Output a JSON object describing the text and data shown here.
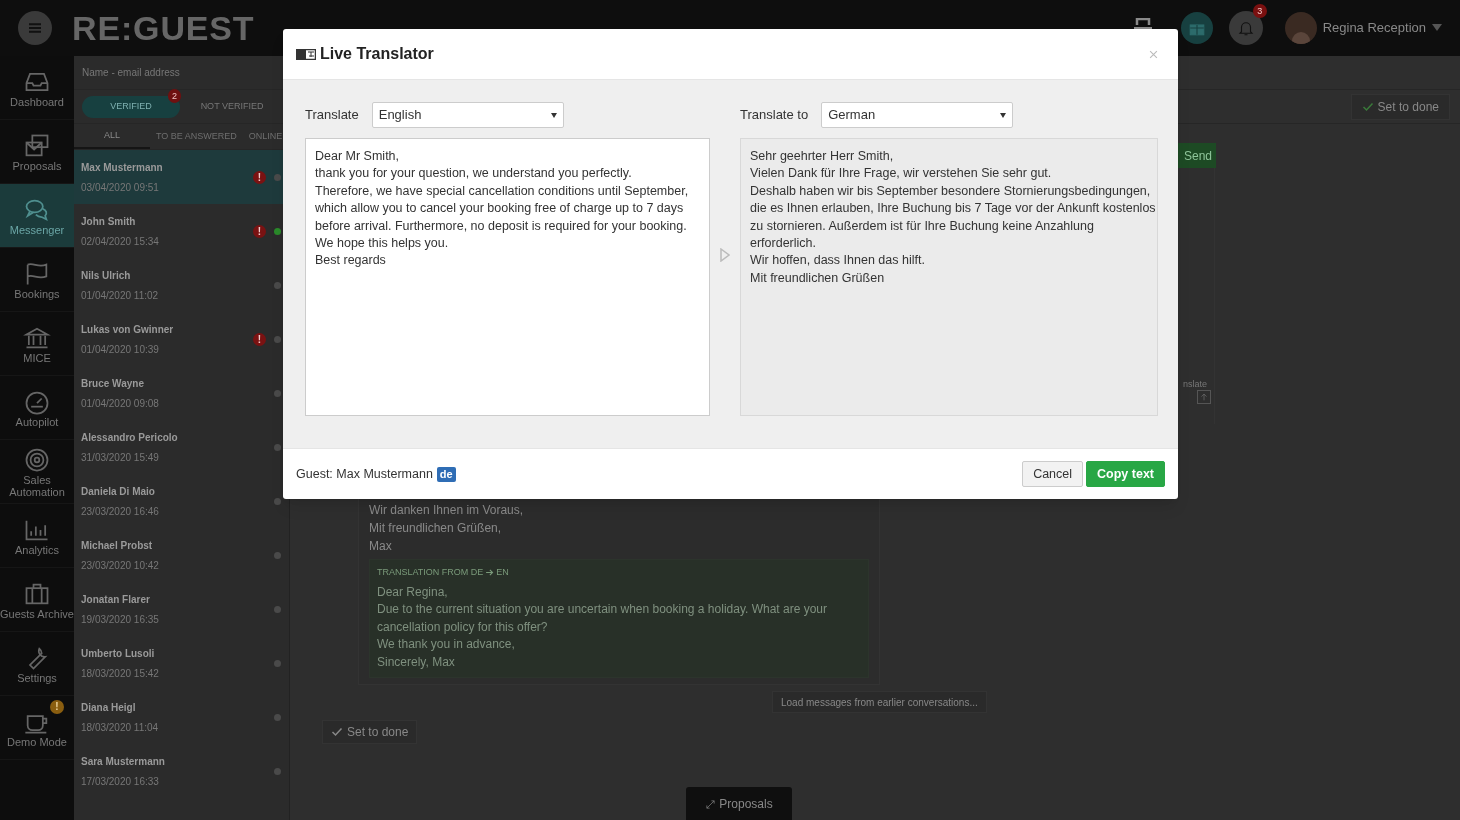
{
  "header": {
    "logo": "RE:GUEST",
    "notifications": "3",
    "user": "Regina Reception"
  },
  "nav": [
    {
      "label": "Dashboard",
      "selected": false
    },
    {
      "label": "Proposals",
      "selected": false
    },
    {
      "label": "Messenger",
      "selected": true
    },
    {
      "label": "Bookings",
      "selected": false
    },
    {
      "label": "MICE",
      "selected": false
    },
    {
      "label": "Autopilot",
      "selected": false
    },
    {
      "label": "Sales Automation",
      "selected": false
    },
    {
      "label": "Analytics",
      "selected": false
    },
    {
      "label": "Guests Archive",
      "selected": false
    },
    {
      "label": "Settings",
      "selected": false
    },
    {
      "label": "Demo Mode",
      "selected": false,
      "badge": "!"
    }
  ],
  "conversations_panel": {
    "search": {
      "placeholder": "Name - email address"
    },
    "filters": [
      {
        "label": "VERIFIED",
        "selected": true,
        "badge": "2"
      },
      {
        "label": "NOT VERIFIED",
        "selected": false
      }
    ],
    "tabs": [
      {
        "label": "ALL",
        "selected": true
      },
      {
        "label": "TO BE ANSWERED",
        "selected": false
      },
      {
        "label": "ONLINE",
        "selected": false
      }
    ],
    "items": [
      {
        "name": "Max Mustermann",
        "date": "03/04/2020 09:51",
        "selected": true,
        "alert": "!",
        "online": false
      },
      {
        "name": "John Smith",
        "date": "02/04/2020 15:34",
        "selected": false,
        "alert": "!",
        "online": true
      },
      {
        "name": "Nils Ulrich",
        "date": "01/04/2020 11:02",
        "selected": false,
        "alert": false,
        "online": false
      },
      {
        "name": "Lukas von Gwinner",
        "date": "01/04/2020 10:39",
        "selected": false,
        "alert": "!",
        "online": false
      },
      {
        "name": "Bruce Wayne",
        "date": "01/04/2020 09:08",
        "selected": false,
        "alert": false,
        "online": false
      },
      {
        "name": "Alessandro Pericolo",
        "date": "31/03/2020 15:49",
        "selected": false,
        "alert": false,
        "online": false
      },
      {
        "name": "Daniela Di Maio",
        "date": "23/03/2020 16:46",
        "selected": false,
        "alert": false,
        "online": false
      },
      {
        "name": "Michael Probst",
        "date": "23/03/2020 10:42",
        "selected": false,
        "alert": false,
        "online": false
      },
      {
        "name": "Jonatan Flarer",
        "date": "19/03/2020 16:35",
        "selected": false,
        "alert": false,
        "online": false
      },
      {
        "name": "Umberto Lusoli",
        "date": "18/03/2020 15:42",
        "selected": false,
        "alert": false,
        "online": false
      },
      {
        "name": "Diana Heigl",
        "date": "18/03/2020 11:04",
        "selected": false,
        "alert": false,
        "online": false
      },
      {
        "name": "Sara Mustermann",
        "date": "17/03/2020 16:33",
        "selected": false,
        "alert": false,
        "online": false
      }
    ]
  },
  "conversation": {
    "set_done_top": "Set to done",
    "send": "Send",
    "translate_fragment": "nslate",
    "message_lines": [
      "Wir danken Ihnen im Voraus,",
      "Mit freundlichen Grüßen,",
      "Max"
    ],
    "translation": {
      "label": "TRANSLATION FROM DE",
      "target": "EN",
      "text": "Dear Regina,\nDue to the current situation you are uncertain when booking a holiday. What are your\ncancellation policy for this offer?\nWe thank you in advance,\nSincerely, Max"
    },
    "load_earlier": "Load messages from earlier conversations...",
    "set_done_bottom": "Set to done",
    "proposals_tab": "Proposals"
  },
  "modal": {
    "title": "Live Translator",
    "source": {
      "label": "Translate",
      "language": "English",
      "text": "Dear Mr Smith,\nthank you for your question, we understand you perfectly.\nTherefore, we have special cancellation conditions until September,\nwhich allow you to cancel your booking free of charge up to 7 days\nbefore arrival. Furthermore, no deposit is required for your booking.\nWe hope this helps you.\nBest regards"
    },
    "target": {
      "label": "Translate to",
      "language": "German",
      "text": "Sehr geehrter Herr Smith,\nVielen Dank für Ihre Frage, wir verstehen Sie sehr gut.\nDeshalb haben wir bis September besondere Stornierungsbedingungen,\ndie es Ihnen erlauben, Ihre Buchung bis 7 Tage vor der Ankunft kostenlos\nzu stornieren. Außerdem ist für Ihre Buchung keine Anzahlung\nerforderlich.\nWir hoffen, dass Ihnen das hilft.\nMit freundlichen Grüßen"
    },
    "guest": "Guest: Max Mustermann",
    "guest_lang": "de",
    "buttons": [
      {
        "label": "Cancel",
        "kind": "secondary"
      },
      {
        "label": "Copy text",
        "kind": "primary"
      }
    ]
  }
}
